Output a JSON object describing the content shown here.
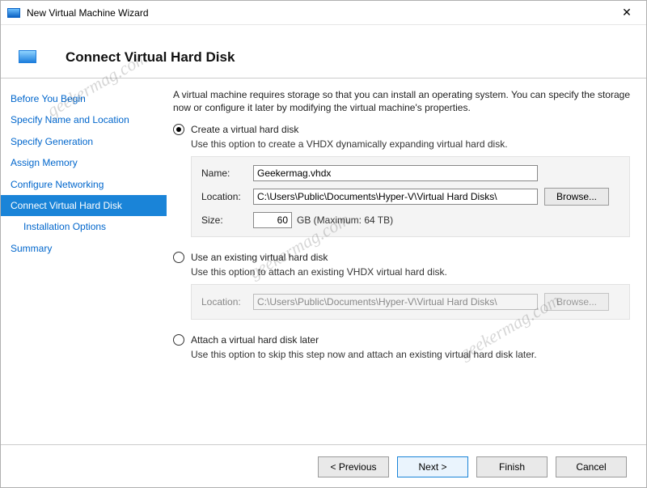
{
  "window": {
    "title": "New Virtual Machine Wizard"
  },
  "header": {
    "title": "Connect Virtual Hard Disk"
  },
  "sidebar": {
    "steps": [
      "Before You Begin",
      "Specify Name and Location",
      "Specify Generation",
      "Assign Memory",
      "Configure Networking",
      "Connect Virtual Hard Disk",
      "Installation Options",
      "Summary"
    ],
    "selected": 5,
    "sub_indices": [
      6
    ]
  },
  "intro": "A virtual machine requires storage so that you can install an operating system. You can specify the storage now or configure it later by modifying the virtual machine's properties.",
  "option_create": {
    "label": "Create a virtual hard disk",
    "desc": "Use this option to create a VHDX dynamically expanding virtual hard disk.",
    "name_label": "Name:",
    "name_value": "Geekermag.vhdx",
    "location_label": "Location:",
    "location_value": "C:\\Users\\Public\\Documents\\Hyper-V\\Virtual Hard Disks\\",
    "browse_label": "Browse...",
    "size_label": "Size:",
    "size_value": "60",
    "size_suffix": "GB (Maximum: 64 TB)"
  },
  "option_existing": {
    "label": "Use an existing virtual hard disk",
    "desc": "Use this option to attach an existing VHDX virtual hard disk.",
    "location_label": "Location:",
    "location_value": "C:\\Users\\Public\\Documents\\Hyper-V\\Virtual Hard Disks\\",
    "browse_label": "Browse..."
  },
  "option_later": {
    "label": "Attach a virtual hard disk later",
    "desc": "Use this option to skip this step now and attach an existing virtual hard disk later."
  },
  "footer": {
    "previous": "< Previous",
    "next": "Next >",
    "finish": "Finish",
    "cancel": "Cancel"
  },
  "watermark": "geekermag.com"
}
